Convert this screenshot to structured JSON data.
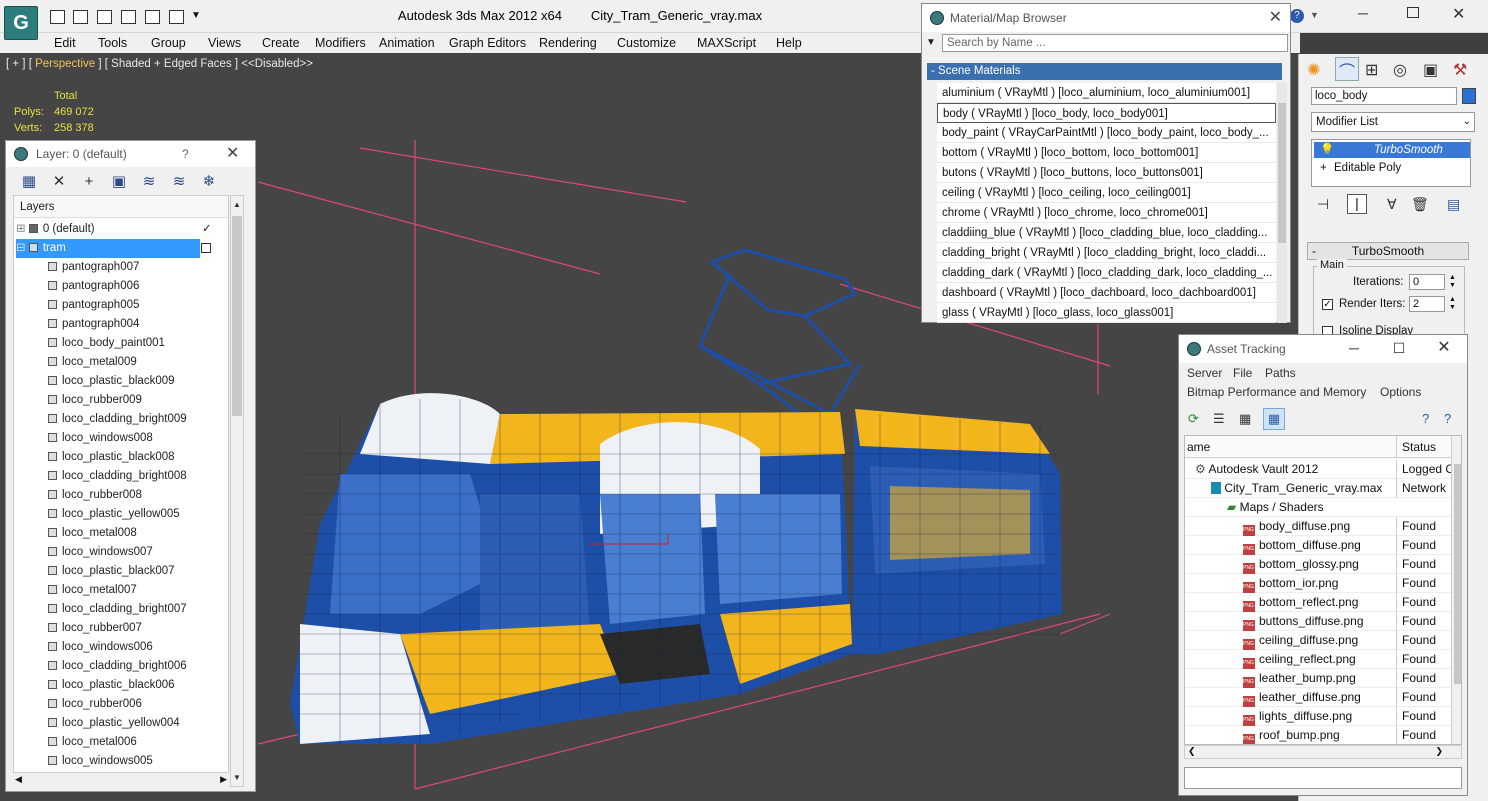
{
  "app": {
    "title": "Autodesk 3ds Max  2012 x64",
    "file": "City_Tram_Generic_vray.max"
  },
  "menu": [
    "Edit",
    "Tools",
    "Group",
    "Views",
    "Create",
    "Modifiers",
    "Animation",
    "Graph Editors",
    "Rendering",
    "Customize",
    "MAXScript",
    "Help"
  ],
  "viewport": {
    "label_plus": "[ + ]",
    "label_view": "Perspective",
    "label_shading": "[ Shaded + Edged Faces ]",
    "label_disabled": "<<Disabled>>",
    "stats_header": "Total",
    "polys_label": "Polys:",
    "polys_value": "469 072",
    "verts_label": "Verts:",
    "verts_value": "258 378",
    "colors": {
      "body_yellow": "#f2b51c",
      "wire_blue": "#1e4fa8",
      "grid_pink": "#e0467c",
      "background": "#454545"
    }
  },
  "layer_panel": {
    "title": "Layer: 0 (default)",
    "help": "?",
    "header": "Layers",
    "rows": [
      {
        "label": "0 (default)",
        "type": "layer"
      },
      {
        "label": "tram",
        "type": "layer",
        "selected": true
      },
      {
        "label": "pantograph007"
      },
      {
        "label": "pantograph006"
      },
      {
        "label": "pantograph005"
      },
      {
        "label": "pantograph004"
      },
      {
        "label": "loco_body_paint001"
      },
      {
        "label": "loco_metal009"
      },
      {
        "label": "loco_plastic_black009"
      },
      {
        "label": "loco_rubber009"
      },
      {
        "label": "loco_cladding_bright009"
      },
      {
        "label": "loco_windows008"
      },
      {
        "label": "loco_plastic_black008"
      },
      {
        "label": "loco_cladding_bright008"
      },
      {
        "label": "loco_rubber008"
      },
      {
        "label": "loco_plastic_yellow005"
      },
      {
        "label": "loco_metal008"
      },
      {
        "label": "loco_windows007"
      },
      {
        "label": "loco_plastic_black007"
      },
      {
        "label": "loco_metal007"
      },
      {
        "label": "loco_cladding_bright007"
      },
      {
        "label": "loco_rubber007"
      },
      {
        "label": "loco_windows006"
      },
      {
        "label": "loco_cladding_bright006"
      },
      {
        "label": "loco_plastic_black006"
      },
      {
        "label": "loco_rubber006"
      },
      {
        "label": "loco_plastic_yellow004"
      },
      {
        "label": "loco_metal006"
      },
      {
        "label": "loco_windows005"
      }
    ]
  },
  "material_browser": {
    "title": "Material/Map Browser",
    "search_placeholder": "Search by Name ...",
    "section": "- Scene Materials",
    "items": [
      "aluminium  ( VRayMtl ) [loco_aluminium, loco_aluminium001]",
      "body  ( VRayMtl ) [loco_body, loco_body001]",
      "body_paint  ( VRayCarPaintMtl ) [loco_body_paint, loco_body_...",
      "bottom  ( VRayMtl ) [loco_bottom, loco_bottom001]",
      "butons  ( VRayMtl ) [loco_buttons, loco_buttons001]",
      "ceiling  ( VRayMtl ) [loco_ceiling, loco_ceiling001]",
      "chrome  ( VRayMtl ) [loco_chrome, loco_chrome001]",
      "claddiing_blue  ( VRayMtl ) [loco_cladding_blue, loco_cladding...",
      "cladding_bright  ( VRayMtl ) [loco_cladding_bright, loco_claddi...",
      "cladding_dark  ( VRayMtl ) [loco_cladding_dark, loco_cladding_...",
      "dashboard  ( VRayMtl ) [loco_dachboard, loco_dachboard001]",
      "glass  ( VRayMtl ) [loco_glass, loco_glass001]"
    ]
  },
  "command_panel": {
    "object_name": "loco_body",
    "color_swatch": "#2b6fd0",
    "modifier_list": "Modifier List",
    "stack": [
      "TurboSmooth",
      "Editable Poly"
    ],
    "rollout_title": "TurboSmooth",
    "group_main": "Main",
    "iterations_label": "Iterations:",
    "iterations_value": "0",
    "render_iters_label": "Render Iters:",
    "render_iters_value": "2",
    "isoline_label": "Isoline Display"
  },
  "asset_tracking": {
    "title": "Asset Tracking",
    "menu": [
      "Server",
      "File",
      "Paths",
      "Bitmap Performance and Memory",
      "Options"
    ],
    "col_name": "ame",
    "col_status": "Status",
    "rows": [
      {
        "name": "Autodesk Vault 2012",
        "status": "Logged C",
        "indent": 0,
        "icon": "vault"
      },
      {
        "name": "City_Tram_Generic_vray.max",
        "status": "Network",
        "indent": 1,
        "icon": "max"
      },
      {
        "name": "Maps / Shaders",
        "status": "",
        "indent": 2,
        "icon": "maps"
      },
      {
        "name": "body_diffuse.png",
        "status": "Found",
        "indent": 3,
        "icon": "png"
      },
      {
        "name": "bottom_diffuse.png",
        "status": "Found",
        "indent": 3,
        "icon": "png"
      },
      {
        "name": "bottom_glossy.png",
        "status": "Found",
        "indent": 3,
        "icon": "png"
      },
      {
        "name": "bottom_ior.png",
        "status": "Found",
        "indent": 3,
        "icon": "png"
      },
      {
        "name": "bottom_reflect.png",
        "status": "Found",
        "indent": 3,
        "icon": "png"
      },
      {
        "name": "buttons_diffuse.png",
        "status": "Found",
        "indent": 3,
        "icon": "png"
      },
      {
        "name": "ceiling_diffuse.png",
        "status": "Found",
        "indent": 3,
        "icon": "png"
      },
      {
        "name": "ceiling_reflect.png",
        "status": "Found",
        "indent": 3,
        "icon": "png"
      },
      {
        "name": "leather_bump.png",
        "status": "Found",
        "indent": 3,
        "icon": "png"
      },
      {
        "name": "leather_diffuse.png",
        "status": "Found",
        "indent": 3,
        "icon": "png"
      },
      {
        "name": "lights_diffuse.png",
        "status": "Found",
        "indent": 3,
        "icon": "png"
      },
      {
        "name": "roof_bump.png",
        "status": "Found",
        "indent": 3,
        "icon": "png"
      }
    ]
  }
}
